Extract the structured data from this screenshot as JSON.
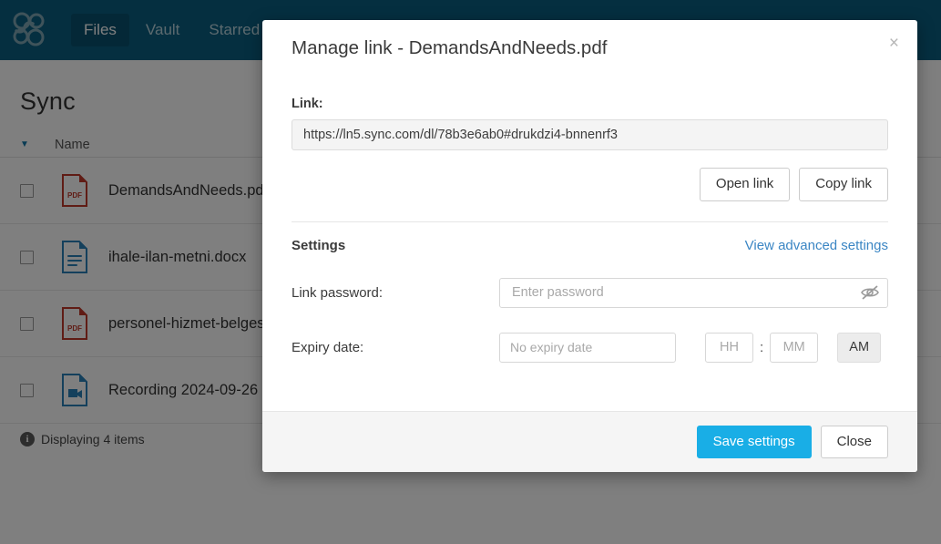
{
  "app": {
    "brand_icon": "sync-logo-icon",
    "nav": [
      {
        "label": "Files",
        "icon": "files-icon",
        "active": true
      },
      {
        "label": "Vault",
        "icon": "vault-icon",
        "active": false
      },
      {
        "label": "Starred",
        "icon": "star-icon",
        "active": false
      }
    ]
  },
  "page": {
    "title": "Sync",
    "table": {
      "sort_caret": "▼",
      "columns": [
        "Name"
      ],
      "rows": [
        {
          "name": "DemandsAndNeeds.pdf",
          "icon": "pdf-file-icon"
        },
        {
          "name": "ihale-ilan-metni.docx",
          "icon": "doc-file-icon"
        },
        {
          "name": "personel-hizmet-belges",
          "icon": "pdf-file-icon"
        },
        {
          "name": "Recording 2024-09-26",
          "icon": "video-file-icon"
        }
      ]
    },
    "status": {
      "icon": "info-icon",
      "text": "Displaying 4 items",
      "badge": "i"
    }
  },
  "modal": {
    "title": "Manage link - DemandsAndNeeds.pdf",
    "close_glyph": "×",
    "link": {
      "label": "Link:",
      "value": "https://ln5.sync.com/dl/78b3e6ab0#drukdzi4-bnnenrf3",
      "open_label": "Open link",
      "copy_label": "Copy link"
    },
    "settings": {
      "heading": "Settings",
      "advanced_link": "View advanced settings",
      "password": {
        "label": "Link password:",
        "value": "",
        "placeholder": "Enter password",
        "toggle_icon": "eye-off-icon"
      },
      "expiry": {
        "label": "Expiry date:",
        "date_value": "",
        "date_placeholder": "No expiry date",
        "calendar_icon": "calendar-icon",
        "hour_value": "",
        "hour_placeholder": "HH",
        "separator": ":",
        "minute_value": "",
        "minute_placeholder": "MM",
        "meridiem": "AM"
      }
    },
    "footer": {
      "save_label": "Save settings",
      "close_label": "Close"
    }
  },
  "colors": {
    "navbar": "#0a5f80",
    "primary": "#19aee6",
    "link": "#3b86c4",
    "pdf_icon": "#c0392b",
    "doc_icon": "#2980b9",
    "overlay": "#808080"
  }
}
